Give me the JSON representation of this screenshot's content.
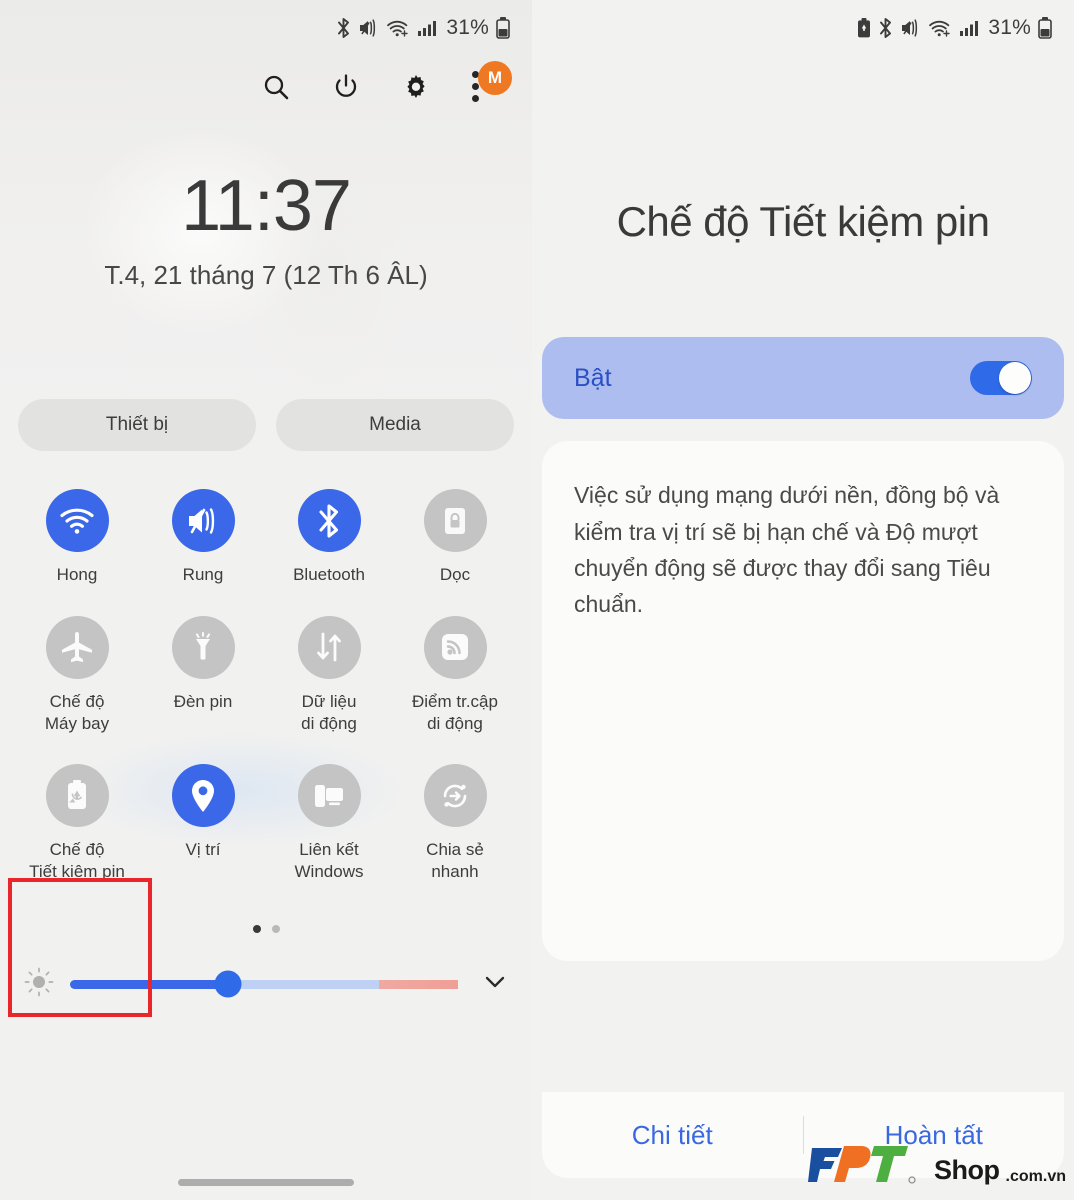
{
  "left": {
    "statusbar": {
      "icons": [
        "bluetooth-icon",
        "mute-vibrate-icon",
        "wifi-icon",
        "signal-icon"
      ],
      "battery_pct": "31%"
    },
    "header": {
      "search_icon": "search-icon",
      "power_icon": "power-icon",
      "settings_icon": "gear-icon",
      "menu_icon": "more-vertical-icon",
      "avatar_initial": "M"
    },
    "clock": {
      "time": "11:37",
      "date": "T.4, 21 tháng 7 (12 Th 6 ÂL)"
    },
    "chips": [
      {
        "label": "Thiết bị"
      },
      {
        "label": "Media"
      }
    ],
    "tiles": [
      [
        {
          "label": "Hong",
          "icon": "wifi-icon",
          "active": true
        },
        {
          "label": "Rung",
          "icon": "vibrate-icon",
          "active": true
        },
        {
          "label": "Bluetooth",
          "icon": "bluetooth-icon",
          "active": true
        },
        {
          "label": "Dọc",
          "icon": "rotation-lock-icon",
          "active": false
        }
      ],
      [
        {
          "label": "Chế độ\nMáy bay",
          "icon": "airplane-icon",
          "active": false
        },
        {
          "label": "Đèn pin",
          "icon": "flashlight-icon",
          "active": false
        },
        {
          "label": "Dữ liệu\ndi động",
          "icon": "mobile-data-icon",
          "active": false
        },
        {
          "label": "Điểm tr.cập\ndi động",
          "icon": "hotspot-icon",
          "active": false
        }
      ],
      [
        {
          "label": "Chế độ\nTiết kiệm pin",
          "icon": "battery-saver-icon",
          "active": false
        },
        {
          "label": "Vị trí",
          "icon": "location-pin-icon",
          "active": true
        },
        {
          "label": "Liên kết\nWindows",
          "icon": "link-to-windows-icon",
          "active": false
        },
        {
          "label": "Chia sẻ\nnhanh",
          "icon": "quick-share-icon",
          "active": false
        }
      ]
    ],
    "pagination": {
      "total": 2,
      "current": 1
    },
    "brightness": {
      "icon": "brightness-icon",
      "value_pct": 40,
      "expand_icon": "chevron-down-icon"
    }
  },
  "right": {
    "statusbar": {
      "icons": [
        "battery-saver-icon",
        "bluetooth-icon",
        "mute-vibrate-icon",
        "wifi-icon",
        "signal-icon"
      ],
      "battery_pct": "31%"
    },
    "title": "Chế độ Tiết kiệm pin",
    "toggle": {
      "label": "Bật",
      "on": true
    },
    "description": "Việc sử dụng mạng dưới nền, đồng bộ và kiểm tra vị trí sẽ bị hạn chế và Độ mượt chuyển động sẽ được thay đổi sang Tiêu chuẩn.",
    "actions": [
      {
        "label": "Chi tiết"
      },
      {
        "label": "Hoàn tất"
      }
    ]
  },
  "watermark": {
    "letters": [
      "F",
      "P",
      "T"
    ],
    "shop": "Shop",
    "tld": ".com.vn"
  },
  "colors": {
    "accent_blue": "#3b68e8",
    "toggle_card_bg": "#aebdf0",
    "highlight_red": "#e8262c",
    "tile_off": "#c4c4c4",
    "avatar_orange": "#ef7822"
  }
}
